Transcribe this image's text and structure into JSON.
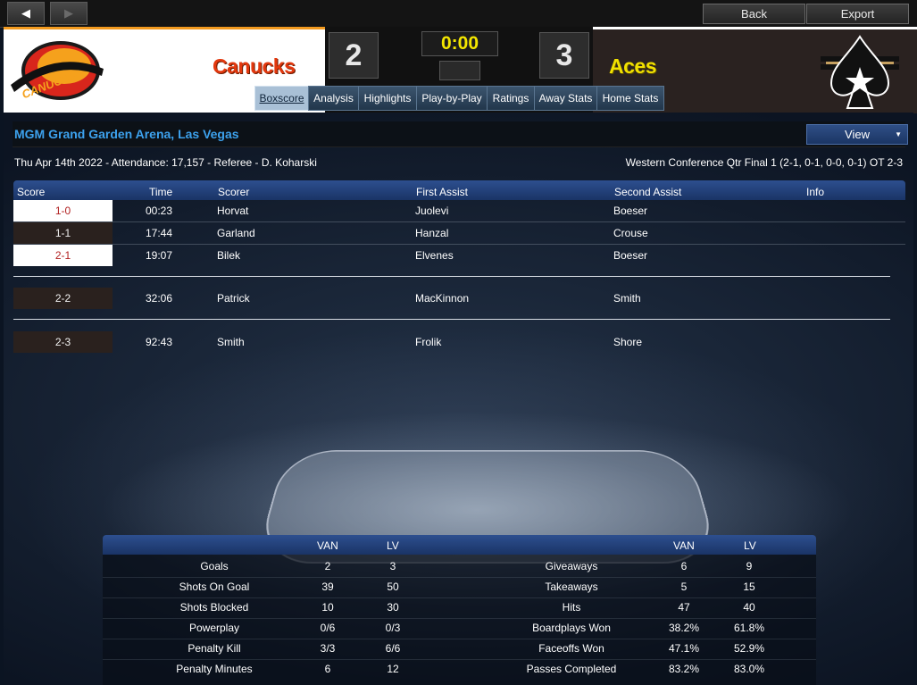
{
  "nav": {
    "back_arrow": "◀",
    "forward_arrow": "▶",
    "back_label": "Back",
    "export_label": "Export"
  },
  "home": {
    "name": "Canucks",
    "score": "2",
    "color": "#f29a1f",
    "text_color": "#e3380e",
    "logo_text": "CANUCKS"
  },
  "away": {
    "name": "Aces",
    "score": "3",
    "text_color": "#f1e100"
  },
  "clock": "0:00",
  "tabs": [
    {
      "label": "Boxscore",
      "active": true
    },
    {
      "label": "Analysis"
    },
    {
      "label": "Highlights"
    },
    {
      "label": "Play-by-Play"
    },
    {
      "label": "Ratings"
    },
    {
      "label": "Away Stats"
    },
    {
      "label": "Home Stats"
    }
  ],
  "venue": "MGM Grand Garden Arena, Las Vegas",
  "view_label": "View",
  "game_info": "Thu Apr 14th 2022 - Attendance: 17,157 - Referee - D. Koharski",
  "series_info": "Western Conference Qtr Final 1 (2-1, 0-1, 0-0, 0-1) OT 2-3",
  "goals_header": {
    "score": "Score",
    "time": "Time",
    "scorer": "Scorer",
    "first_assist": "First Assist",
    "second_assist": "Second Assist",
    "info": "Info"
  },
  "goals": [
    {
      "score": "1-0",
      "team": "home",
      "time": "00:23",
      "scorer": "Horvat",
      "first_assist": "Juolevi",
      "second_assist": "Boeser",
      "info": ""
    },
    {
      "score": "1-1",
      "team": "away",
      "time": "17:44",
      "scorer": "Garland",
      "first_assist": "Hanzal",
      "second_assist": "Crouse",
      "info": ""
    },
    {
      "score": "2-1",
      "team": "home",
      "time": "19:07",
      "scorer": "Bilek",
      "first_assist": "Elvenes",
      "second_assist": "Boeser",
      "info": ""
    },
    {
      "score": "2-2",
      "team": "away",
      "time": "32:06",
      "scorer": "Patrick",
      "first_assist": "MacKinnon",
      "second_assist": "Smith",
      "info": ""
    },
    {
      "score": "2-3",
      "team": "away",
      "time": "92:43",
      "scorer": "Smith",
      "first_assist": "Frolik",
      "second_assist": "Shore",
      "info": ""
    }
  ],
  "stats_header": {
    "van": "VAN",
    "lv": "LV"
  },
  "stats_left": [
    {
      "label": "Goals",
      "van": "2",
      "lv": "3"
    },
    {
      "label": "Shots On Goal",
      "van": "39",
      "lv": "50"
    },
    {
      "label": "Shots Blocked",
      "van": "10",
      "lv": "30"
    },
    {
      "label": "Powerplay",
      "van": "0/6",
      "lv": "0/3"
    },
    {
      "label": "Penalty Kill",
      "van": "3/3",
      "lv": "6/6"
    },
    {
      "label": "Penalty Minutes",
      "van": "6",
      "lv": "12"
    }
  ],
  "stats_right": [
    {
      "label": "Giveaways",
      "van": "6",
      "lv": "9"
    },
    {
      "label": "Takeaways",
      "van": "5",
      "lv": "15"
    },
    {
      "label": "Hits",
      "van": "47",
      "lv": "40"
    },
    {
      "label": "Boardplays Won",
      "van": "38.2%",
      "lv": "61.8%"
    },
    {
      "label": "Faceoffs Won",
      "van": "47.1%",
      "lv": "52.9%"
    },
    {
      "label": "Passes Completed",
      "van": "83.2%",
      "lv": "83.0%"
    }
  ]
}
